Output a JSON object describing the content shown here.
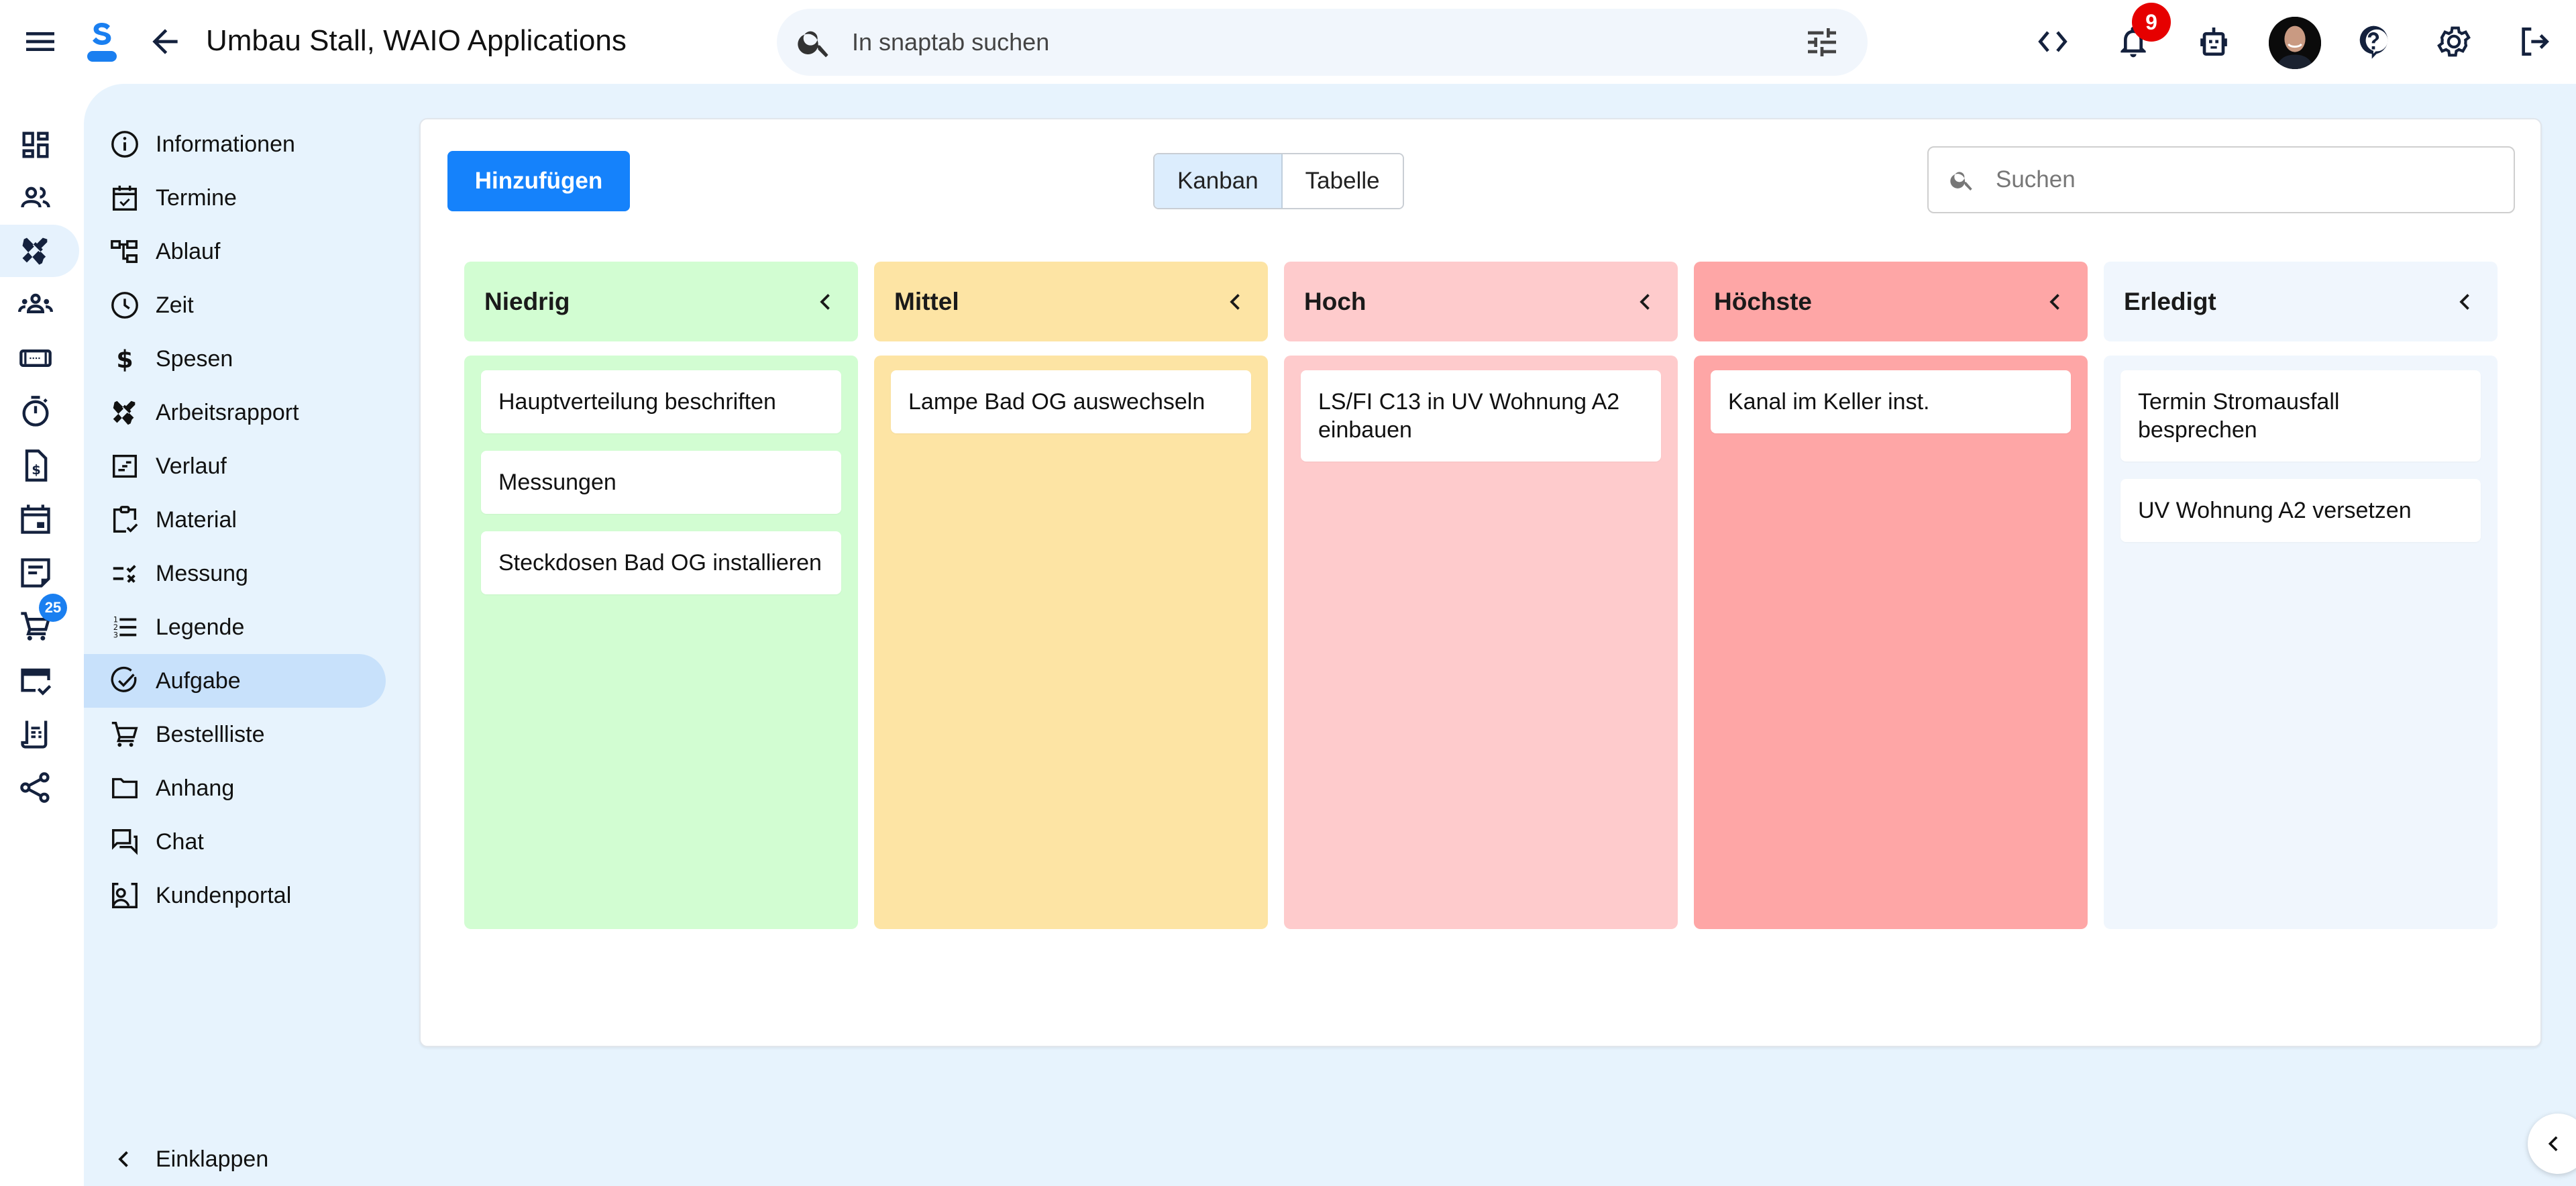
{
  "header": {
    "title": "Umbau Stall, WAIO Applications",
    "search_placeholder": "In snaptab suchen",
    "notification_count": "9"
  },
  "colors": {
    "brand": "#1582fb",
    "icon": "#14213d",
    "badge_red": "#e60000",
    "badge_blue": "#1a7ff0",
    "content_bg": "#e7f3fd",
    "active_nav": "#c8e1fb"
  },
  "rail": {
    "items": [
      {
        "icon": "dashboard-icon"
      },
      {
        "icon": "contacts-icon"
      },
      {
        "icon": "tools-icon",
        "active": true
      },
      {
        "icon": "team-icon"
      },
      {
        "icon": "ticket-icon"
      },
      {
        "icon": "timer-icon"
      },
      {
        "icon": "invoice-icon"
      },
      {
        "icon": "calendar-icon"
      },
      {
        "icon": "note-icon"
      },
      {
        "icon": "cart-icon",
        "badge": "25"
      },
      {
        "icon": "payment-check-icon"
      },
      {
        "icon": "receipt-icon"
      },
      {
        "icon": "share-icon"
      }
    ]
  },
  "nav": {
    "items": [
      {
        "label": "Informationen",
        "icon": "info-icon"
      },
      {
        "label": "Termine",
        "icon": "calendar-check-icon"
      },
      {
        "label": "Ablauf",
        "icon": "flow-icon"
      },
      {
        "label": "Zeit",
        "icon": "clock-icon"
      },
      {
        "label": "Spesen",
        "icon": "dollar-icon"
      },
      {
        "label": "Arbeitsrapport",
        "icon": "tools-icon"
      },
      {
        "label": "Verlauf",
        "icon": "history-icon"
      },
      {
        "label": "Material",
        "icon": "clipboard-check-icon"
      },
      {
        "label": "Messung",
        "icon": "measurement-icon"
      },
      {
        "label": "Legende",
        "icon": "numbered-list-icon"
      },
      {
        "label": "Aufgabe",
        "icon": "task-check-icon",
        "active": true
      },
      {
        "label": "Bestellliste",
        "icon": "cart-icon"
      },
      {
        "label": "Anhang",
        "icon": "folder-icon"
      },
      {
        "label": "Chat",
        "icon": "chat-icon"
      },
      {
        "label": "Kundenportal",
        "icon": "portal-icon"
      }
    ],
    "collapse_label": "Einklappen"
  },
  "toolbar": {
    "add_label": "Hinzufügen",
    "views": [
      {
        "label": "Kanban",
        "active": true
      },
      {
        "label": "Tabelle",
        "active": false
      }
    ],
    "search_placeholder": "Suchen"
  },
  "board": {
    "columns": [
      {
        "title": "Niedrig",
        "head_color": "#d2fdd2",
        "body_color": "#d2fdd2",
        "tasks": [
          "Hauptverteilung beschriften",
          "Messungen",
          "Steckdosen Bad OG installieren"
        ]
      },
      {
        "title": "Mittel",
        "head_color": "#fde4a4",
        "body_color": "#fde4a4",
        "tasks": [
          "Lampe Bad OG auswechseln"
        ]
      },
      {
        "title": "Hoch",
        "head_color": "#fecbcc",
        "body_color": "#fecbcc",
        "tasks": [
          "LS/FI C13 in UV Wohnung A2 einbauen"
        ]
      },
      {
        "title": "Höchste",
        "head_color": "#fea6a6",
        "body_color": "#fea6a6",
        "tasks": [
          "Kanal im Keller inst."
        ]
      },
      {
        "title": "Erledigt",
        "head_color": "#f0f6fd",
        "body_color": "#f0f6fd",
        "tasks": [
          "Termin Stromausfall besprechen",
          "UV Wohnung A2 versetzen"
        ]
      }
    ]
  }
}
